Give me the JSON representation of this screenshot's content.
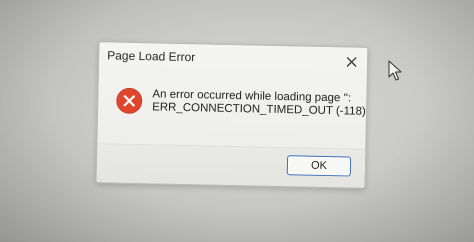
{
  "dialog": {
    "title": "Page Load Error",
    "message_line1": "An error occurred while loading page '':",
    "message_line2": "ERR_CONNECTION_TIMED_OUT (-118)",
    "ok_label": "OK",
    "icon": "error-icon",
    "close_icon": "close-icon"
  },
  "colors": {
    "error_red": "#e0462c",
    "button_border": "#3d6fb5",
    "dialog_bg": "#f0f0ee"
  },
  "cursor": {
    "icon": "mouse-pointer-icon"
  }
}
